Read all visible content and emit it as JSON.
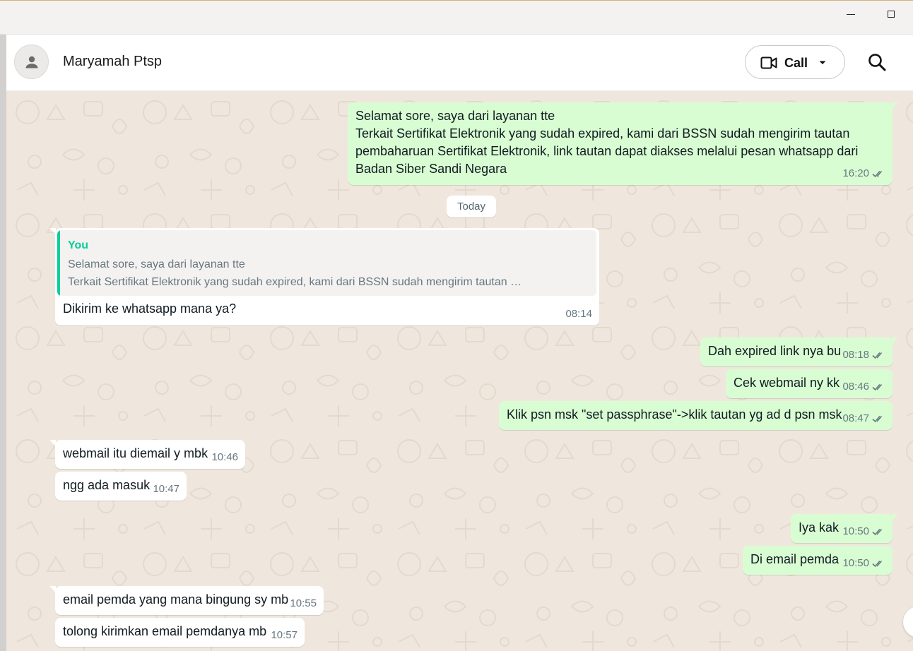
{
  "window": {
    "minimize_icon": "minimize-icon",
    "maximize_icon": "maximize-icon"
  },
  "header": {
    "contact_name": "Maryamah Ptsp",
    "avatar_icon": "person-icon",
    "call_label": "Call",
    "call_icon": "video-camera-icon",
    "search_icon": "search-icon"
  },
  "colors": {
    "outgoing": "#d9fdd3",
    "incoming": "#ffffff",
    "accent": "#06cf9c",
    "wallpaper": "#efe7dd"
  },
  "date_separator": "Today",
  "messages": [
    {
      "direction": "out",
      "lines": [
        "Selamat sore, saya dari layanan tte",
        "Terkait Sertifikat Elektronik yang sudah expired, kami dari BSSN sudah mengirim tautan",
        "pembaharuan Sertifikat Elektronik, link tautan dapat diakses melalui pesan whatsapp dari",
        "Badan Siber Sandi Negara"
      ],
      "time": "16:20",
      "status": "read"
    },
    {
      "direction": "in",
      "quote": {
        "author": "You",
        "line1": "Selamat sore, saya dari layanan tte",
        "line2": "Terkait Sertifikat Elektronik yang sudah expired, kami dari BSSN sudah mengirim tautan …"
      },
      "text": "Dikirim ke whatsapp mana ya?",
      "time": "08:14"
    },
    {
      "direction": "out",
      "text": "Dah expired link nya bu",
      "time": "08:18",
      "status": "read"
    },
    {
      "direction": "out",
      "text": "Cek webmail ny kk",
      "time": "08:46",
      "status": "read"
    },
    {
      "direction": "out",
      "text": "Klik psn msk \"set passphrase\"->klik tautan yg ad d psn msk",
      "time": "08:47",
      "status": "read"
    },
    {
      "direction": "in",
      "text": "webmail itu diemail y mbk",
      "time": "10:46"
    },
    {
      "direction": "in",
      "text": "ngg ada masuk",
      "time": "10:47"
    },
    {
      "direction": "out",
      "text": "Iya kak",
      "time": "10:50",
      "status": "read"
    },
    {
      "direction": "out",
      "text": "Di email pemda",
      "time": "10:50",
      "status": "read"
    },
    {
      "direction": "in",
      "text": "email pemda yang mana bingung sy mb",
      "time": "10:55"
    },
    {
      "direction": "in",
      "text": "tolong kirimkan email pemdanya mb",
      "time": "10:57"
    }
  ]
}
